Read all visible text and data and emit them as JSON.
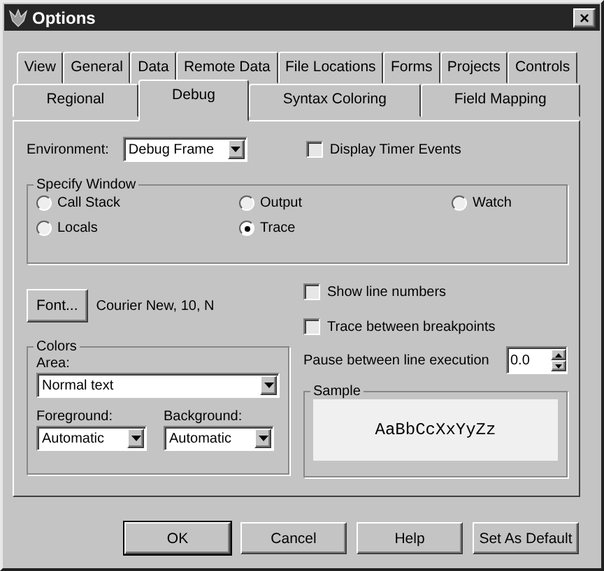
{
  "window": {
    "title": "Options",
    "close": "×"
  },
  "tab_rows": [
    [
      {
        "label": "View",
        "selected": false
      },
      {
        "label": "General",
        "selected": false
      },
      {
        "label": "Data",
        "selected": false
      },
      {
        "label": "Remote Data",
        "selected": false
      },
      {
        "label": "File Locations",
        "selected": false
      },
      {
        "label": "Forms",
        "selected": false
      },
      {
        "label": "Projects",
        "selected": false
      },
      {
        "label": "Controls",
        "selected": false
      }
    ],
    [
      {
        "label": "Regional",
        "selected": false
      },
      {
        "label": "Debug",
        "selected": true
      },
      {
        "label": "Syntax Coloring",
        "selected": false
      },
      {
        "label": "Field Mapping",
        "selected": false
      }
    ]
  ],
  "environment": {
    "label": "Environment:",
    "value": "Debug Frame"
  },
  "display_timer_events": {
    "label": "Display Timer Events",
    "checked": false
  },
  "specify_window": {
    "title": "Specify Window",
    "options": [
      {
        "label": "Call Stack",
        "selected": false
      },
      {
        "label": "Output",
        "selected": false
      },
      {
        "label": "Watch",
        "selected": false
      },
      {
        "label": "Locals",
        "selected": false
      },
      {
        "label": "Trace",
        "selected": true
      }
    ]
  },
  "font": {
    "button": "Font...",
    "description": "Courier New, 10, N"
  },
  "checkboxes": [
    {
      "label": "Show line numbers",
      "checked": false
    },
    {
      "label": "Trace between breakpoints",
      "checked": false
    }
  ],
  "pause": {
    "label": "Pause between line execution",
    "value": "0.0"
  },
  "colors": {
    "title": "Colors",
    "area_label": "Area:",
    "area_value": "Normal text",
    "foreground_label": "Foreground:",
    "foreground_value": "Automatic",
    "background_label": "Background:",
    "background_value": "Automatic"
  },
  "sample": {
    "title": "Sample",
    "text": "AaBbCcXxYyZz"
  },
  "buttons": [
    {
      "label": "OK",
      "default": true
    },
    {
      "label": "Cancel",
      "default": false
    },
    {
      "label": "Help",
      "default": false
    },
    {
      "label": "Set As Default",
      "default": false
    }
  ]
}
